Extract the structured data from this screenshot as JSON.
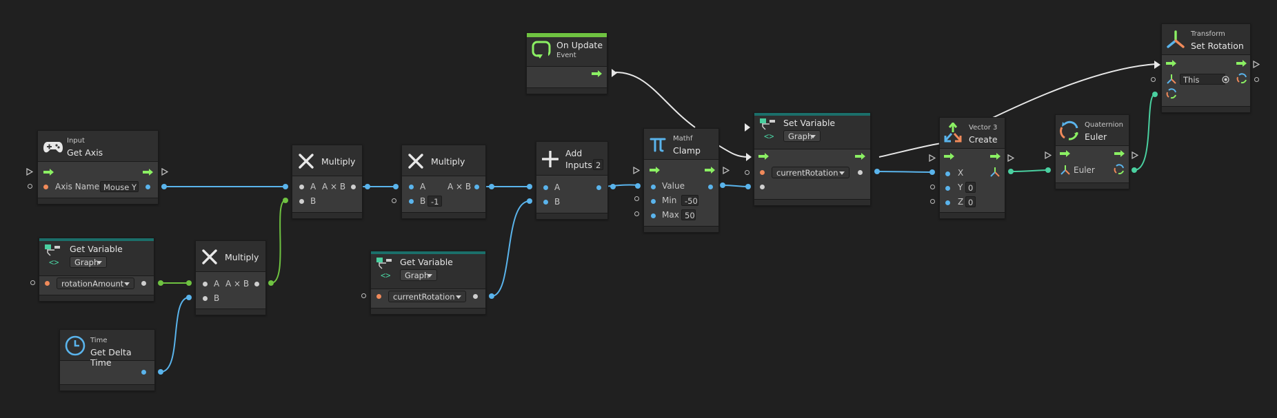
{
  "nodes": {
    "get_axis": {
      "category": "Input",
      "title": "Get Axis",
      "axis_label": "Axis Name",
      "axis_value": "Mouse Y"
    },
    "get_variable_1": {
      "title": "Get Variable",
      "scope": "Graph",
      "variable": "rotationAmount"
    },
    "time": {
      "category": "Time",
      "title": "Get Delta Time"
    },
    "multiply_1": {
      "title": "Multiply",
      "a": "A",
      "b": "B",
      "out": "A × B"
    },
    "multiply_2": {
      "title": "Multiply",
      "a": "A",
      "b": "B",
      "out": "A × B"
    },
    "multiply_3": {
      "title": "Multiply",
      "a": "A",
      "b": "B",
      "out": "A × B",
      "b_value": "-1"
    },
    "get_variable_2": {
      "title": "Get Variable",
      "scope": "Graph",
      "variable": "currentRotation"
    },
    "add": {
      "title": "Add",
      "title2": "Inputs",
      "inputs": "2",
      "a": "A",
      "b": "B"
    },
    "on_update": {
      "title": "On Update",
      "category": "Event"
    },
    "clamp": {
      "category": "Mathf",
      "title": "Clamp",
      "value": "Value",
      "min_label": "Min",
      "min_value": "-50",
      "max_label": "Max",
      "max_value": "50"
    },
    "set_variable": {
      "title": "Set Variable",
      "scope": "Graph",
      "variable": "currentRotation"
    },
    "vector3": {
      "category": "Vector 3",
      "title": "Create",
      "x": "X",
      "y": "Y",
      "z": "Z",
      "y_value": "0",
      "z_value": "0"
    },
    "quaternion": {
      "category": "Quaternion",
      "title": "Euler",
      "euler": "Euler"
    },
    "set_rotation": {
      "category": "Transform",
      "title": "Set Rotation",
      "target": "This"
    }
  },
  "colors": {
    "background": "#202020",
    "node": "#3a3a3a",
    "float_port": "#5ab4ec",
    "int_port": "#6fc341",
    "flow": "#8bf063",
    "object_port": "#f08a5a",
    "quaternion_port": "#4ad0a0",
    "wire_flow": "#e8e8e8"
  },
  "icons": {
    "get_axis": "gamepad-icon",
    "variable": "variable-icon",
    "time": "clock-icon",
    "multiply": "multiply-icon",
    "add": "plus-icon",
    "on_update": "update-loop-icon",
    "clamp": "pi-icon",
    "vector3": "vector-axes-icon",
    "quaternion": "rotation-icon",
    "transform": "transform-axes-icon"
  }
}
